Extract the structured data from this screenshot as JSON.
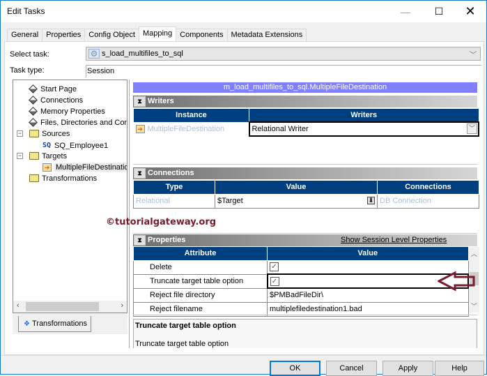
{
  "window": {
    "title": "Edit Tasks",
    "controls": {
      "minimize": "—",
      "maximize": "☐",
      "close": "✕"
    }
  },
  "tabs": [
    {
      "label": "General",
      "active": false
    },
    {
      "label": "Properties",
      "active": false
    },
    {
      "label": "Config Object",
      "active": false
    },
    {
      "label": "Mapping",
      "active": true
    },
    {
      "label": "Components",
      "active": false
    },
    {
      "label": "Metadata Extensions",
      "active": false
    }
  ],
  "form": {
    "select_task_label": "Select task:",
    "select_task_value": "s_load_multifiles_to_sql",
    "select_task_icon": "gear-icon",
    "task_type_label": "Task type:",
    "task_type_value": "Session"
  },
  "tree": {
    "items": [
      {
        "label": "Start Page",
        "icon": "diamond-icon"
      },
      {
        "label": "Connections",
        "icon": "diamond-icon"
      },
      {
        "label": "Memory Properties",
        "icon": "diamond-icon"
      },
      {
        "label": "Files, Directories and Com",
        "icon": "diamond-icon"
      },
      {
        "label": "Sources",
        "icon": "folder-icon",
        "expander": "−"
      },
      {
        "label": "SQ_Employee1",
        "icon": "sq-icon",
        "icon_text": "SQ"
      },
      {
        "label": "Targets",
        "icon": "folder-icon",
        "expander": "−"
      },
      {
        "label": "MultipleFileDestination",
        "icon": "target-icon",
        "selected": true
      },
      {
        "label": "Transformations",
        "icon": "folder-icon"
      }
    ],
    "bottom_tab": "Transformations"
  },
  "mapping": {
    "title": "m_load_multifiles_to_sql.MultipleFileDestination",
    "writers": {
      "section_label": "Writers",
      "columns": [
        "Instance",
        "Writers"
      ],
      "rows": [
        {
          "instance": "MultipleFileDestination",
          "writer": "Relational Writer"
        }
      ]
    },
    "connections": {
      "section_label": "Connections",
      "columns": [
        "Type",
        "Value",
        "Connections"
      ],
      "rows": [
        {
          "type": "Relational",
          "value": "$Target",
          "connection": "DB Connection"
        }
      ]
    },
    "watermark": "©tutorialgateway.org",
    "properties": {
      "section_label": "Properties",
      "link": "Show Session Level Properties",
      "columns": [
        "Attribute",
        "Value"
      ],
      "rows": [
        {
          "attribute": "Delete",
          "value": "",
          "checkbox": true,
          "checked": true
        },
        {
          "attribute": "Truncate target table option",
          "value": "",
          "checkbox": true,
          "checked": true,
          "highlighted": true
        },
        {
          "attribute": "Reject file directory",
          "value": "$PMBadFileDir\\"
        },
        {
          "attribute": "Reject filename",
          "value": "multiplefiledestination1.bad"
        }
      ]
    },
    "description": {
      "title": "Truncate target table option",
      "text": "Truncate target table option"
    }
  },
  "buttons": {
    "ok": "OK",
    "cancel": "Cancel",
    "apply": "Apply",
    "help": "Help"
  },
  "colors": {
    "header_blue": "#003f7f",
    "mapping_title_bg": "#8080ff",
    "annotation_arrow": "#7a1a2a",
    "window_border": "#1979ca"
  }
}
